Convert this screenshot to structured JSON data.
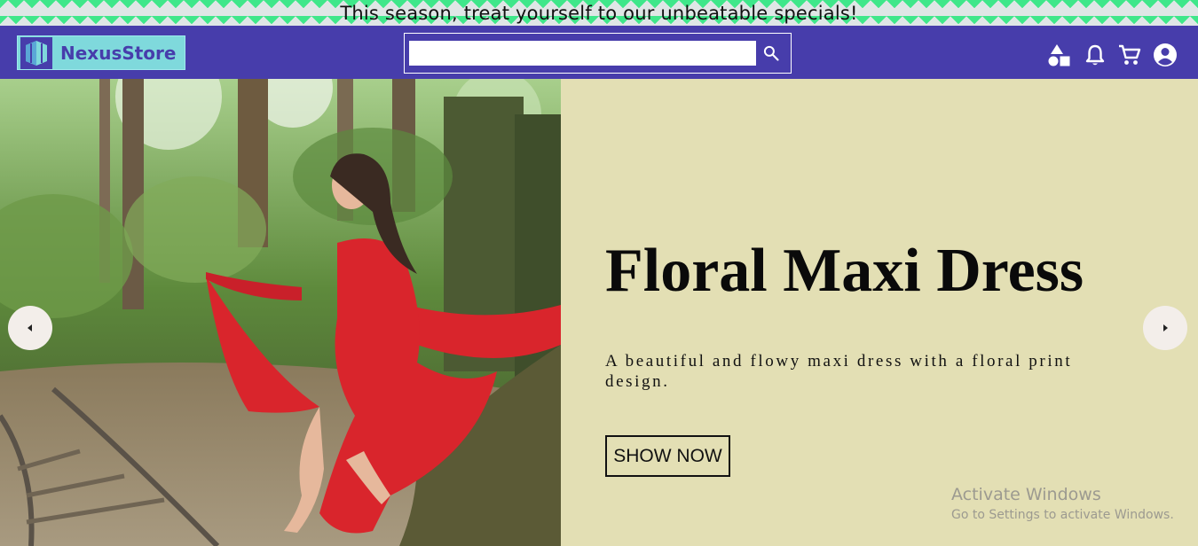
{
  "announcement": {
    "text": "This season, treat yourself to our unbeatable specials!"
  },
  "header": {
    "logo_text": "NexusStore",
    "search": {
      "value": "",
      "placeholder": ""
    },
    "icons": [
      "shapes-icon",
      "bell-icon",
      "cart-icon",
      "account-icon"
    ]
  },
  "hero": {
    "title": "Floral Maxi Dress",
    "description": "A beautiful and flowy maxi dress with a floral print design.",
    "cta_label": "SHOW NOW",
    "image_alt": "Woman in red dress sitting by forest railway"
  },
  "carousel": {
    "prev_icon": "caret-left-icon",
    "next_icon": "caret-right-icon"
  },
  "watermark": {
    "line1": "Activate Windows",
    "line2": "Go to Settings to activate Windows."
  },
  "colors": {
    "nav_bg": "#473dab",
    "logo_bg": "#7fd9dc",
    "hero_panel_bg": "#e3dfb4",
    "announce_green": "#3fe78a",
    "dress_red": "#d9252c"
  }
}
